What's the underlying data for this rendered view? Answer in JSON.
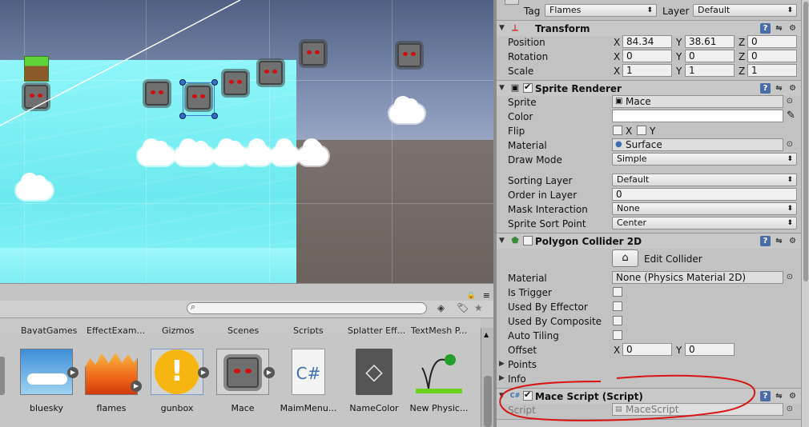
{
  "project": {
    "folders": [
      "BayatGames",
      "EffectExam...",
      "Gizmos",
      "Scenes",
      "Scripts",
      "Splatter Eff...",
      "TextMesh P..."
    ],
    "assets": [
      {
        "label": "bluesky",
        "icon": "sky-image-icon"
      },
      {
        "label": "flames",
        "icon": "flames-image-icon"
      },
      {
        "label": "gunbox",
        "icon": "gunbox-sprite-icon"
      },
      {
        "label": "Mace",
        "icon": "mace-sprite-icon"
      },
      {
        "label": "MaimMenu...",
        "icon": "csharp-script-icon"
      },
      {
        "label": "NameColor",
        "icon": "unity-logo-icon"
      },
      {
        "label": "New Physic...",
        "icon": "physics-material-icon"
      }
    ]
  },
  "inspector": {
    "tag_label": "Tag",
    "tag_value": "Flames",
    "layer_label": "Layer",
    "layer_value": "Default",
    "transform": {
      "title": "Transform",
      "position_label": "Position",
      "rotation_label": "Rotation",
      "scale_label": "Scale",
      "position": {
        "x": "84.34",
        "y": "38.61",
        "z": "0"
      },
      "rotation": {
        "x": "0",
        "y": "0",
        "z": "0"
      },
      "scale": {
        "x": "1",
        "y": "1",
        "z": "1"
      }
    },
    "axis": {
      "x": "X",
      "y": "Y",
      "z": "Z"
    },
    "sprite_renderer": {
      "title": "Sprite Renderer",
      "sprite_label": "Sprite",
      "sprite_value": "Mace",
      "color_label": "Color",
      "flip_label": "Flip",
      "material_label": "Material",
      "material_value": "Surface",
      "draw_mode_label": "Draw Mode",
      "draw_mode_value": "Simple",
      "sorting_layer_label": "Sorting Layer",
      "sorting_layer_value": "Default",
      "order_label": "Order in Layer",
      "order_value": "0",
      "mask_label": "Mask Interaction",
      "mask_value": "None",
      "sort_point_label": "Sprite Sort Point",
      "sort_point_value": "Center"
    },
    "polygon_collider": {
      "title": "Polygon Collider 2D",
      "edit_collider_label": "Edit Collider",
      "material_label": "Material",
      "material_value": "None (Physics Material 2D)",
      "is_trigger_label": "Is Trigger",
      "used_by_effector_label": "Used By Effector",
      "used_by_composite_label": "Used By Composite",
      "auto_tiling_label": "Auto Tiling",
      "offset_label": "Offset",
      "offset": {
        "x": "0",
        "y": "0"
      },
      "points_label": "Points",
      "info_label": "Info"
    },
    "mace_script": {
      "title": "Mace Script (Script)",
      "script_label": "Script",
      "script_value": "MaceScript"
    }
  },
  "colors": {
    "water": "#7ff0f5",
    "ground": "#736a65",
    "sky": "#5b6c92",
    "annotation": "#d81414"
  }
}
